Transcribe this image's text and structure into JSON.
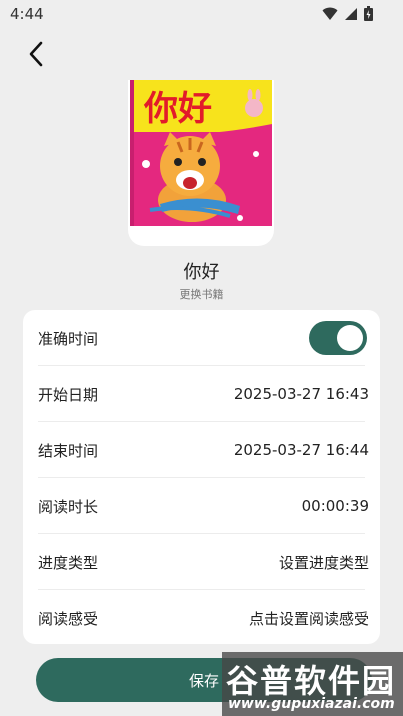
{
  "status_bar": {
    "time": "4:44"
  },
  "book": {
    "cover_text": "你好",
    "title": "你好",
    "change_label": "更换书籍"
  },
  "record": {
    "accurate_time": {
      "label": "准确时间",
      "enabled": true
    },
    "rows": [
      {
        "label": "开始日期",
        "value": "2025-03-27 16:43"
      },
      {
        "label": "结束时间",
        "value": "2025-03-27 16:44"
      },
      {
        "label": "阅读时长",
        "value": "00:00:39"
      },
      {
        "label": "进度类型",
        "value": "设置进度类型"
      },
      {
        "label": "阅读感受",
        "value": "点击设置阅读感受"
      }
    ]
  },
  "save_label": "保存",
  "watermark": {
    "logo": "谷普软件园",
    "url": "www.gupuxiazai.com"
  },
  "colors": {
    "accent": "#2e6a5e",
    "background": "#eeeeee",
    "cover_pink": "#e4287f",
    "cover_yellow": "#f7e31c"
  }
}
